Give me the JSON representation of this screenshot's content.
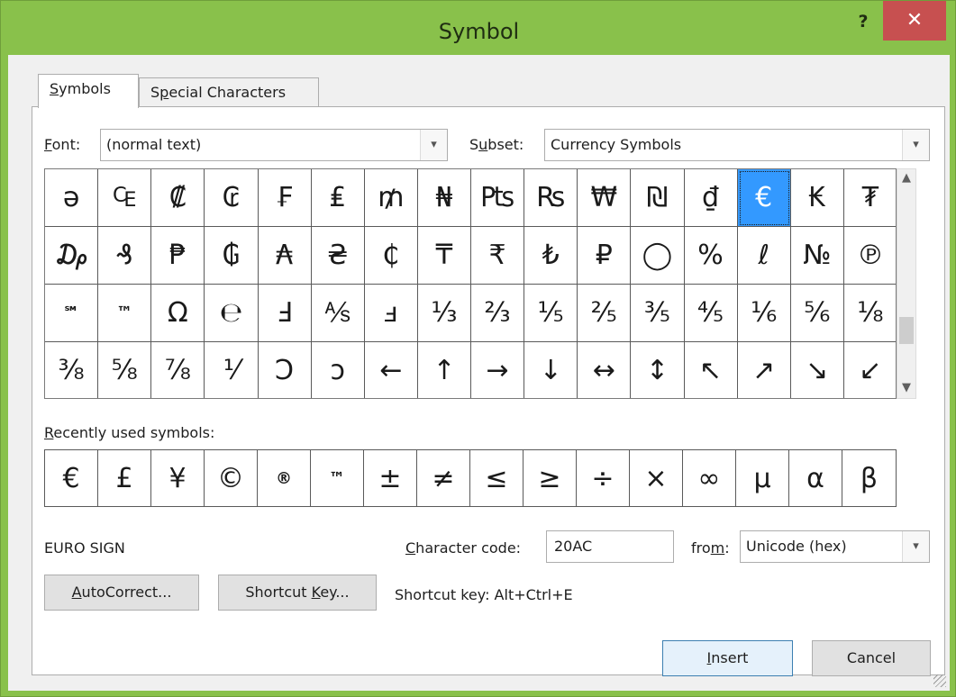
{
  "window": {
    "title": "Symbol",
    "help_glyph": "?",
    "close_glyph": "✕"
  },
  "tabs": [
    {
      "label_prefix": "",
      "label_key": "S",
      "label_suffix": "ymbols",
      "active": true
    },
    {
      "label_prefix": "S",
      "label_key": "p",
      "label_suffix": "ecial Characters",
      "active": false
    }
  ],
  "font": {
    "label_key": "F",
    "label_suffix": "ont:",
    "value": "(normal text)"
  },
  "subset": {
    "label_prefix": "S",
    "label_key": "u",
    "label_suffix": "bset:",
    "value": "Currency Symbols"
  },
  "dropdown_glyph": "▾",
  "scroll": {
    "up_glyph": "▲",
    "down_glyph": "▼",
    "position_fraction": 0.78
  },
  "symbols": [
    [
      "ə",
      "₠",
      "₡",
      "₢",
      "₣",
      "₤",
      "₥",
      "₦",
      "₧",
      "₨",
      "₩",
      "₪",
      "₫",
      "€",
      "₭",
      "₮"
    ],
    [
      "₯",
      "₰",
      "₱",
      "₲",
      "₳",
      "₴",
      "₵",
      "₸",
      "₹",
      "₺",
      "₽",
      "◯",
      "%",
      "ℓ",
      "№",
      "℗"
    ],
    [
      "℠",
      "™",
      "Ω",
      "℮",
      "Ⅎ",
      "⅍",
      "ⅎ",
      "⅓",
      "⅔",
      "⅕",
      "⅖",
      "⅗",
      "⅘",
      "⅙",
      "⅚",
      "⅛"
    ],
    [
      "⅜",
      "⅝",
      "⅞",
      "⅟",
      "Ↄ",
      "ↄ",
      "←",
      "↑",
      "→",
      "↓",
      "↔",
      "↕",
      "↖",
      "↗",
      "↘",
      "↙"
    ]
  ],
  "selected_symbol": "€",
  "recent": {
    "label_key": "R",
    "label_suffix": "ecently used symbols:",
    "items": [
      "€",
      "£",
      "¥",
      "©",
      "®",
      "™",
      "±",
      "≠",
      "≤",
      "≥",
      "÷",
      "×",
      "∞",
      "µ",
      "α",
      "β"
    ]
  },
  "char_name": "EURO SIGN",
  "char_code": {
    "label_key": "C",
    "label_suffix": "haracter code:",
    "value": "20AC"
  },
  "from": {
    "label_prefix": "fro",
    "label_key": "m",
    "label_suffix": ":",
    "value": "Unicode (hex)"
  },
  "buttons": {
    "autocorrect_key": "A",
    "autocorrect_suffix": "utoCorrect...",
    "shortcut_prefix": "Shortcut ",
    "shortcut_key": "K",
    "shortcut_suffix": "ey...",
    "insert_key": "I",
    "insert_suffix": "nsert",
    "cancel": "Cancel"
  },
  "shortcut_text": "Shortcut key: Alt+Ctrl+E"
}
